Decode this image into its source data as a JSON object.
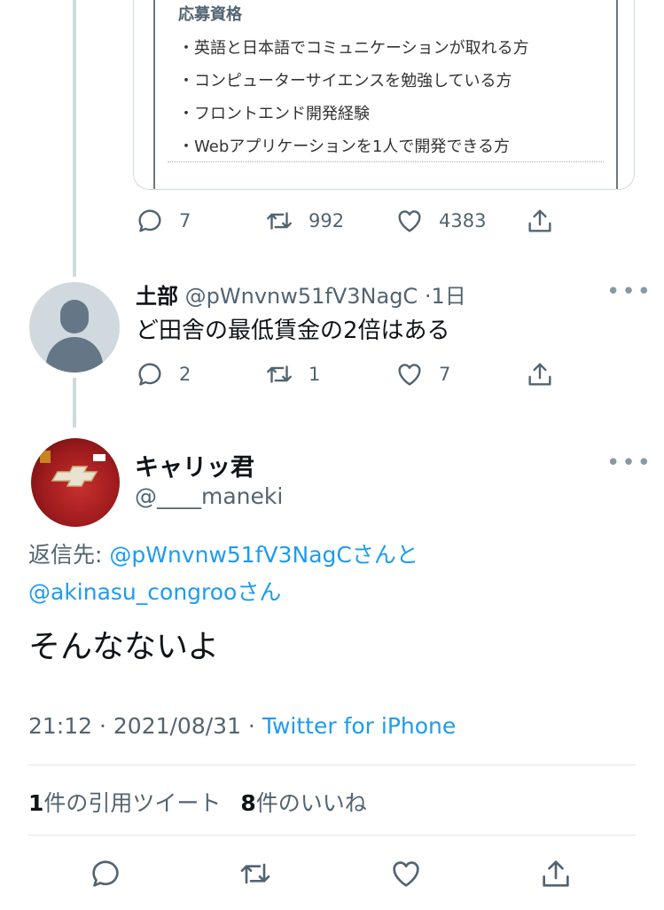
{
  "quoted_card": {
    "heading": "応募資格",
    "lines": [
      "・英語と日本語でコミュニケーションが取れる方",
      "・コンピューターサイエンスを勉強している方",
      "・フロントエンド開発経験",
      "・Webアプリケーションを1人で開発できる方"
    ]
  },
  "tweet1_actions": {
    "replies": "7",
    "retweets": "992",
    "likes": "4383"
  },
  "reply1": {
    "name": "土部",
    "handle": "@pWnvnw51fV3NagC",
    "time": "·1日",
    "text": "ど田舎の最低賃金の2倍はある",
    "replies": "2",
    "retweets": "1",
    "likes": "7"
  },
  "main": {
    "name": "キャリッ君",
    "handle": "@____maneki",
    "replying_prefix": "返信先: ",
    "replying_to_1": "@pWnvnw51fV3NagC",
    "and": "さんと",
    "replying_to_2": "@akinasu_congroo",
    "san": "さん",
    "text": "そんなないよ",
    "timestamp": "21:12 · 2021/08/31 · ",
    "source": "Twitter for iPhone",
    "quote_count": "1",
    "quote_label": "件の引用ツイート",
    "like_count": "8",
    "like_label": "件のいいね"
  },
  "icons": [
    "reply-icon",
    "retweet-icon",
    "like-icon",
    "share-icon",
    "more-icon",
    "avatar"
  ],
  "colors": {
    "link": "#1d9bf0",
    "muted": "#536471",
    "text": "#0f1419"
  }
}
